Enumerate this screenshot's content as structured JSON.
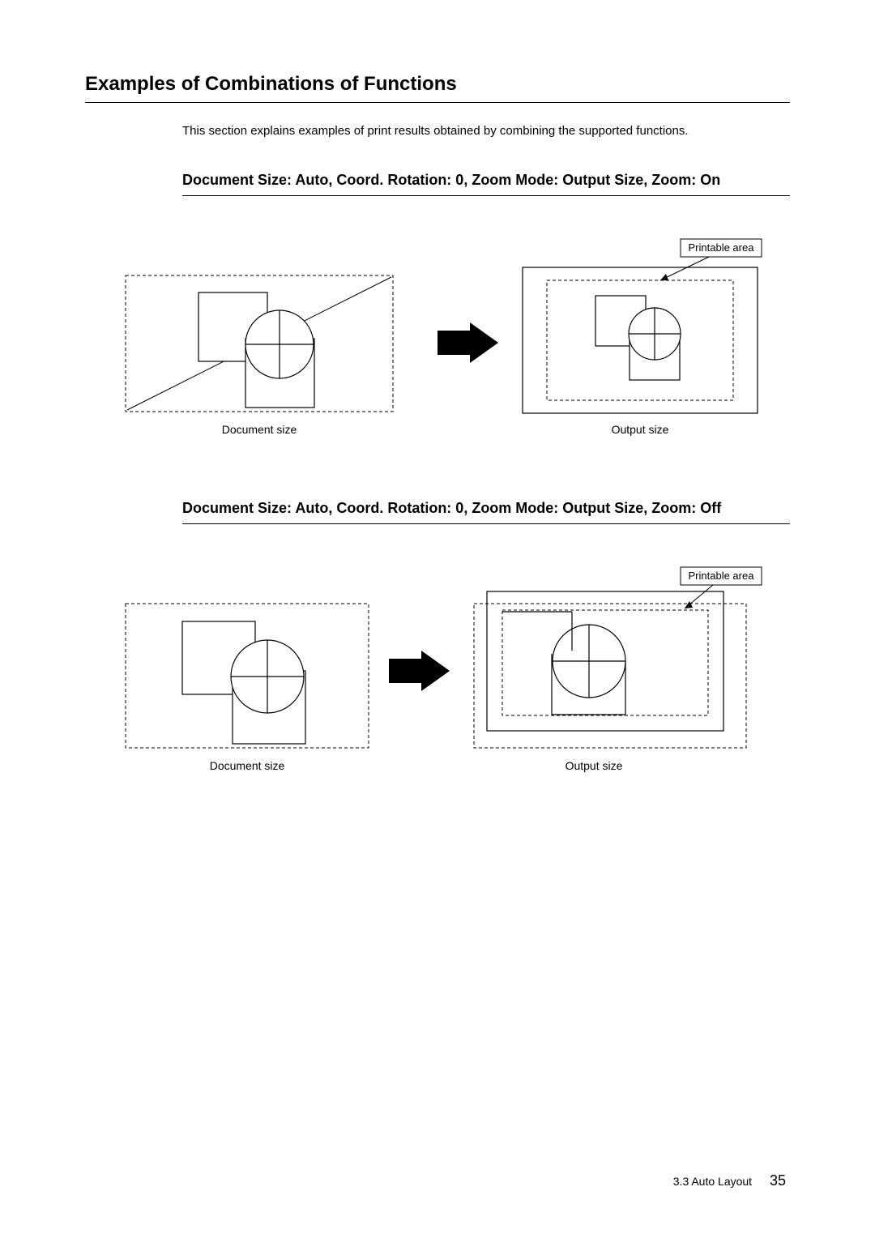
{
  "heading": "Examples of Combinations of Functions",
  "intro": "This section explains examples of print results obtained by combining the supported functions.",
  "sub1": "Document Size: Auto, Coord. Rotation: 0, Zoom Mode: Output Size, Zoom: On",
  "sub2": "Document Size: Auto, Coord. Rotation: 0, Zoom Mode: Output Size, Zoom: Off",
  "labels": {
    "printable_area": "Printable area",
    "document_size": "Document size",
    "output_size": "Output size"
  },
  "footer": {
    "section": "3.3 Auto Layout",
    "page": "35"
  }
}
